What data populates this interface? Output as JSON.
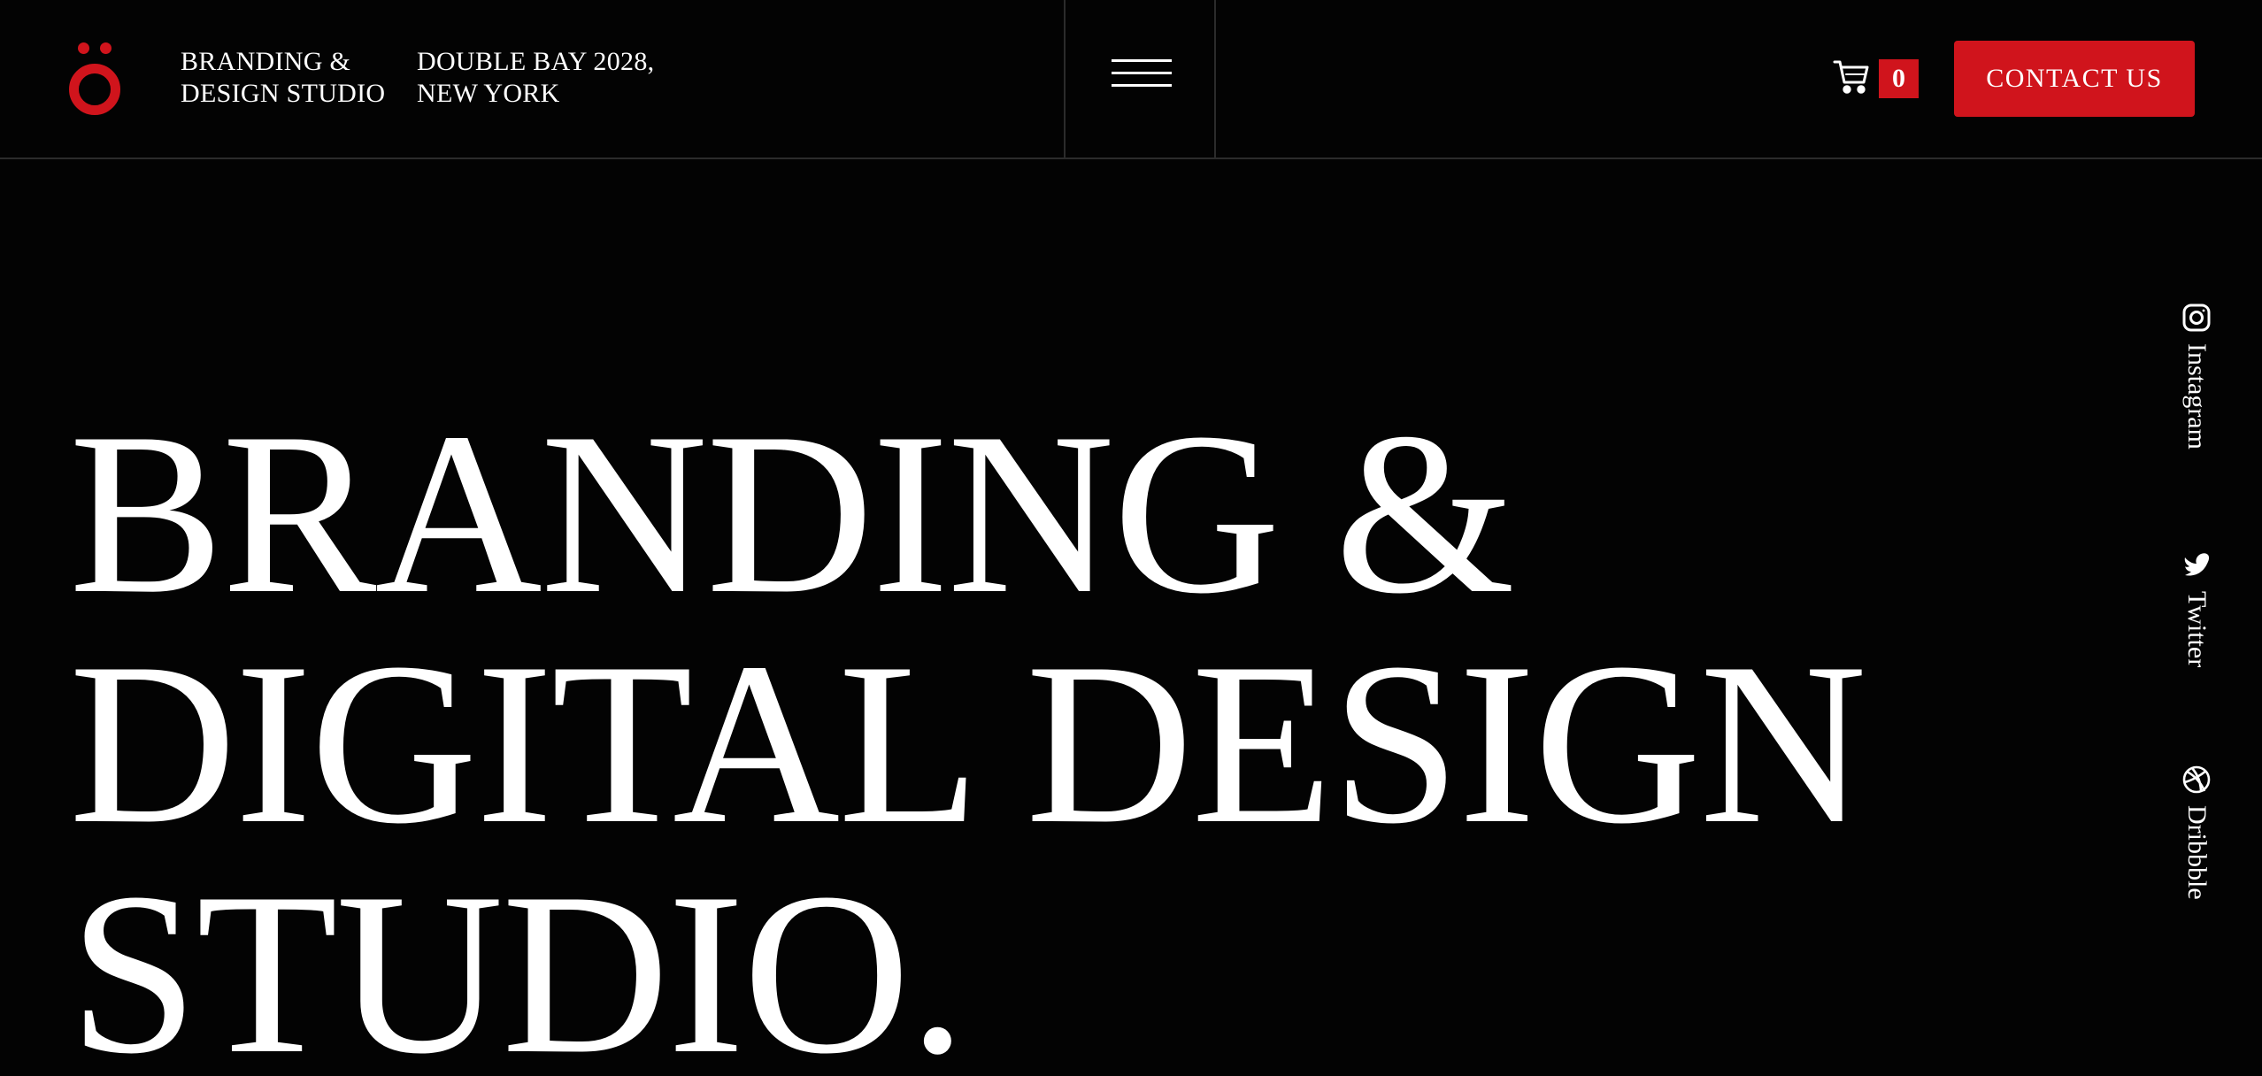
{
  "header": {
    "brand_line1": "BRANDING &",
    "brand_line2": "DESIGN STUDIO",
    "address_line1": "DOUBLE BAY 2028,",
    "address_line2": "NEW YORK",
    "menu_icon": "hamburger-menu-icon",
    "cart_icon": "shopping-cart-icon",
    "cart_count": "0",
    "contact_label": "CONTACT US"
  },
  "hero": {
    "line1": "BRANDING &",
    "line2": "DIGITAL DESIGN",
    "line3": "STUDIO."
  },
  "social": [
    {
      "label": "Instagram",
      "icon": "instagram-icon"
    },
    {
      "label": "Twitter",
      "icon": "twitter-icon"
    },
    {
      "label": "Dribbble",
      "icon": "dribbble-icon"
    }
  ],
  "colors": {
    "background": "#030303",
    "accent": "#d0141c",
    "text": "#ffffff",
    "divider": "#2b2b2b"
  }
}
